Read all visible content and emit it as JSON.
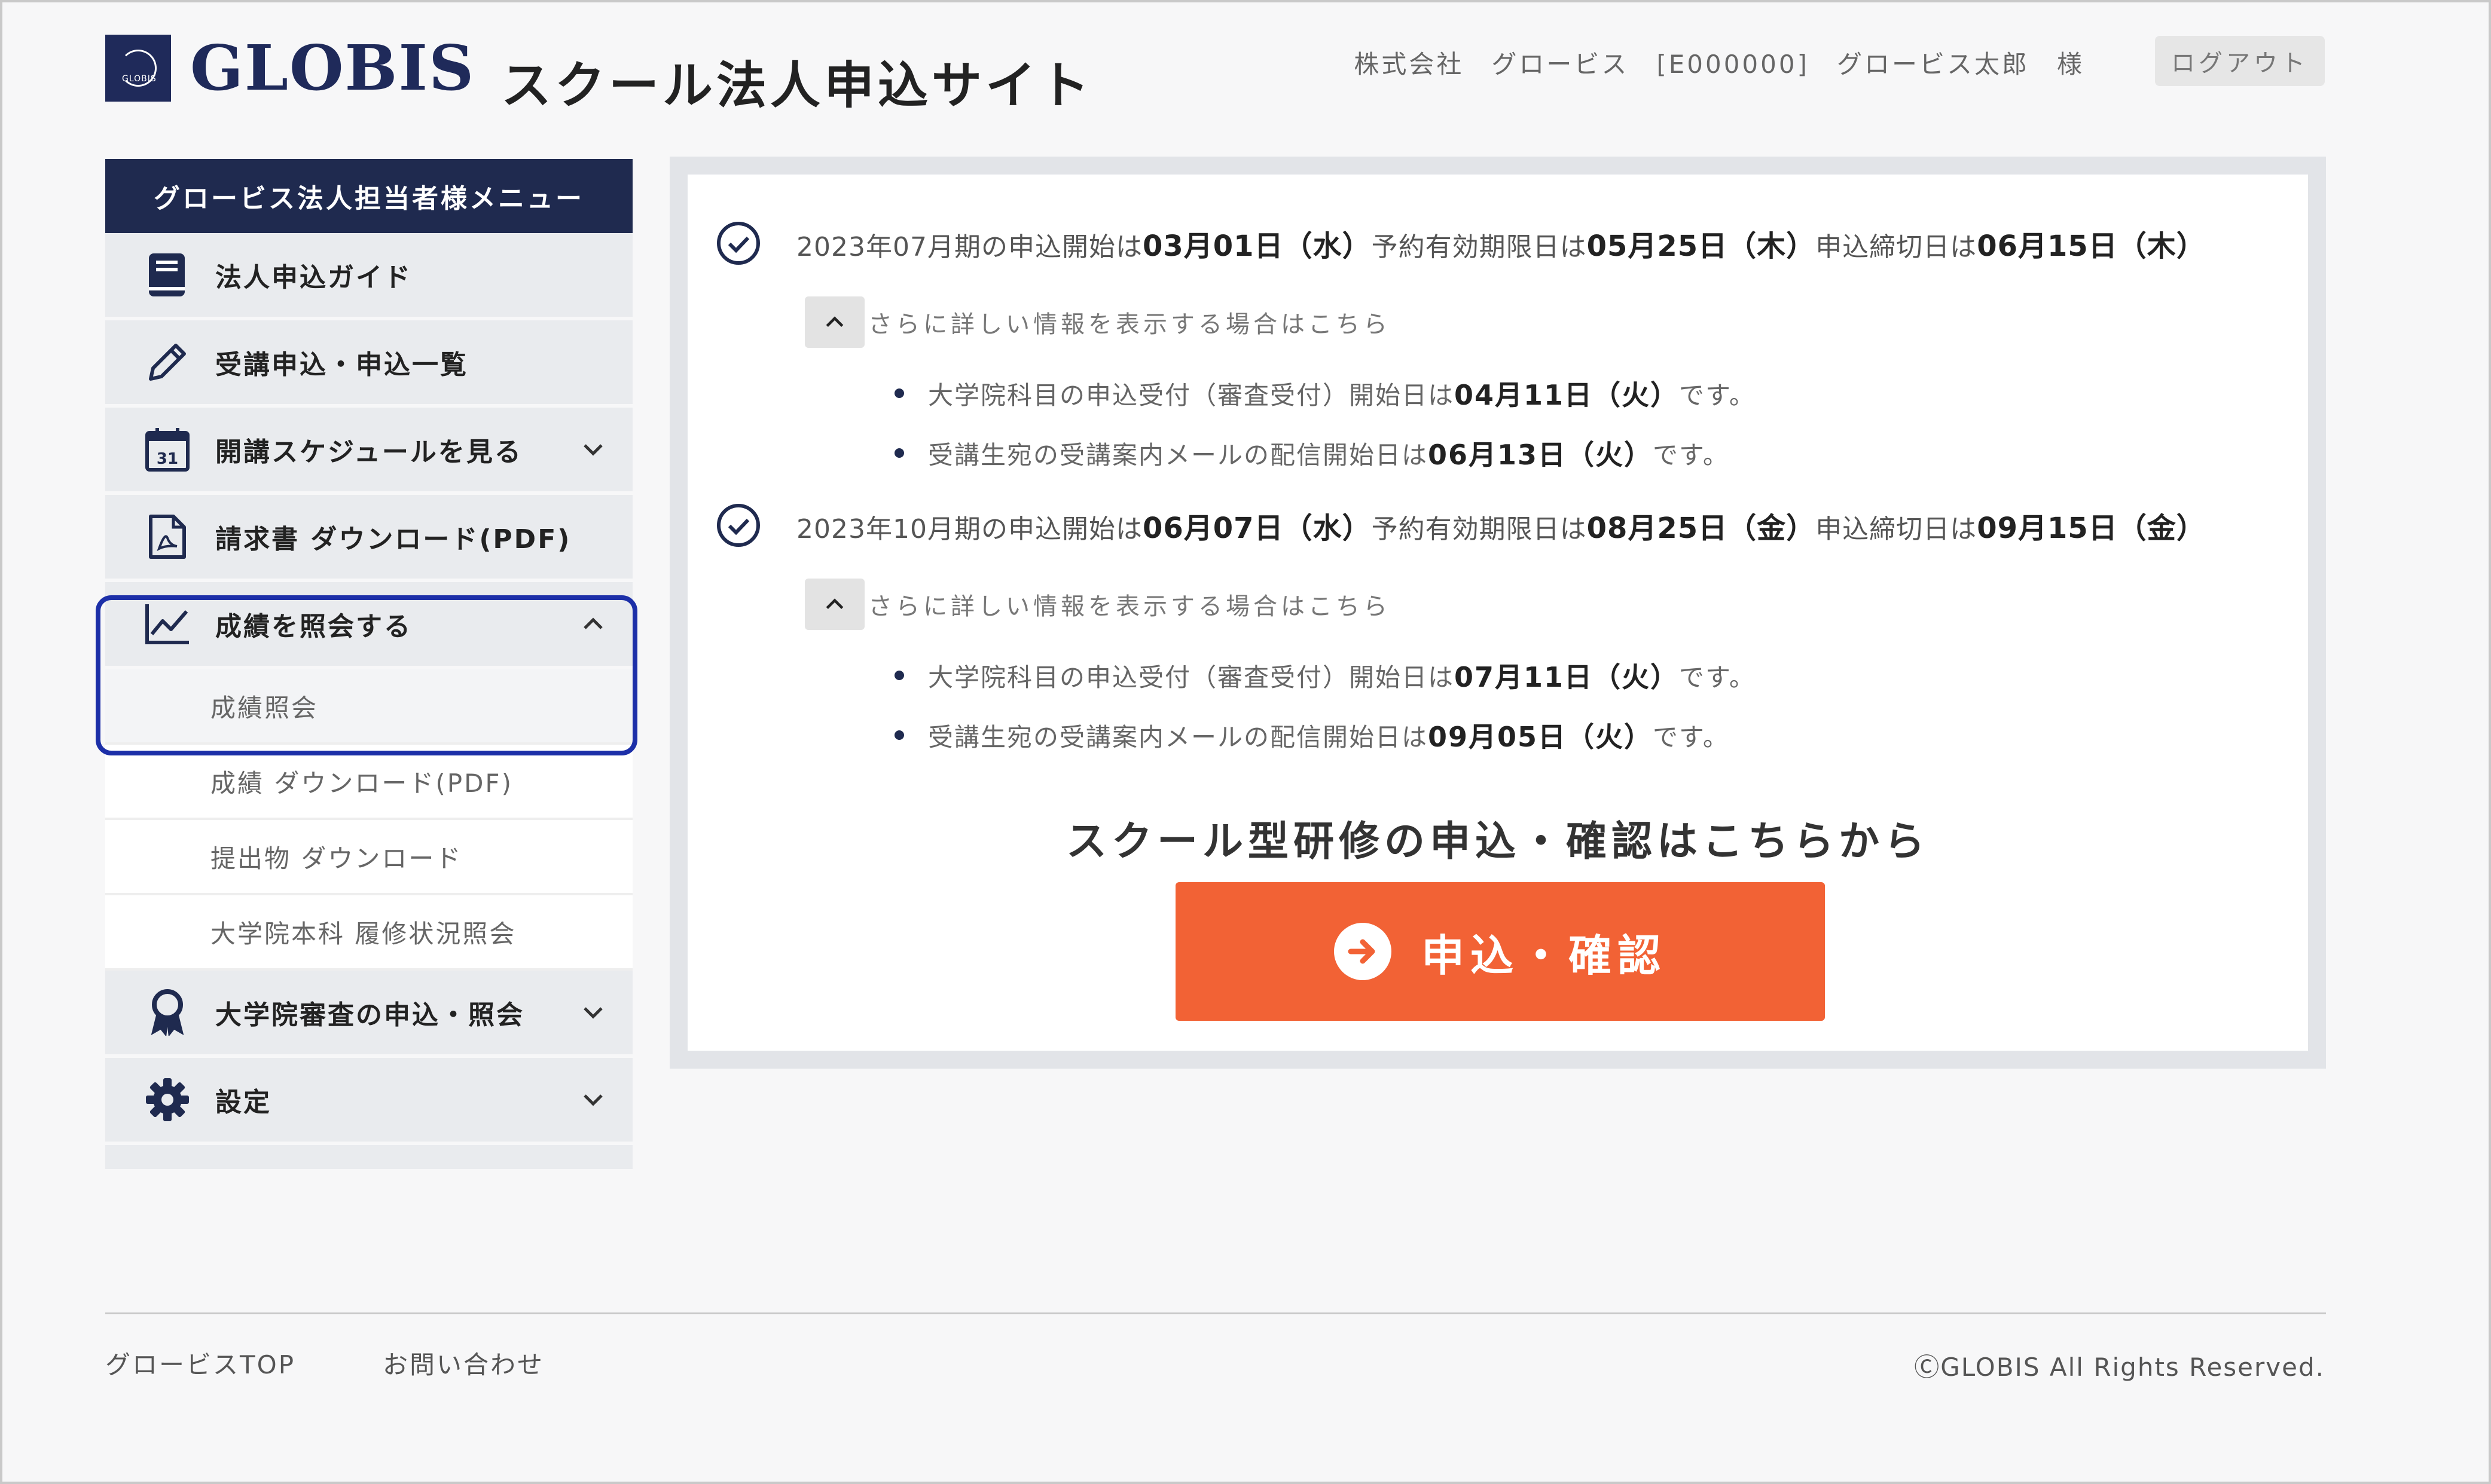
{
  "header": {
    "logo_text": "GLOBIS",
    "logo_small": "GLOBIS",
    "site_title": "スクール法人申込サイト",
    "company": "株式会社　グロービス",
    "code": "[E000000]",
    "user_name": "グロービス太郎　様",
    "logout_label": "ログアウト"
  },
  "sidebar": {
    "title": "グロービス法人担当者様メニュー",
    "items": [
      {
        "label": "法人申込ガイド",
        "icon": "book-icon"
      },
      {
        "label": "受講申込・申込一覧",
        "icon": "pencil-icon"
      },
      {
        "label": "開講スケジュールを見る",
        "icon": "calendar-icon",
        "calendar_day": "31"
      },
      {
        "label": "請求書 ダウンロード(PDF)",
        "icon": "pdf-icon"
      },
      {
        "label": "成績を照会する",
        "icon": "chart-icon"
      }
    ],
    "sub_items": [
      "成績照会",
      "成績 ダウンロード(PDF)",
      "提出物 ダウンロード",
      "大学院本科 履修状況照会"
    ],
    "items_after": [
      {
        "label": "大学院審査の申込・照会",
        "icon": "award-icon"
      },
      {
        "label": "設定",
        "icon": "gear-icon"
      }
    ]
  },
  "periods": [
    {
      "prefix": "2023年07月期の申込開始は",
      "start": "03月01日（水）",
      "mid1": "予約有効期限日は",
      "expiry": "05月25日（木）",
      "mid2": "申込締切日は",
      "deadline": "06月15日（木）",
      "more_text": "さらに詳しい情報を表示する場合はこちら",
      "bullets": [
        {
          "pre": "大学院科目の申込受付（審査受付）開始日は",
          "date": "04月11日（火）",
          "post": "です。"
        },
        {
          "pre": "受講生宛の受講案内メールの配信開始日は",
          "date": "06月13日（火）",
          "post": "です。"
        }
      ]
    },
    {
      "prefix": "2023年10月期の申込開始は",
      "start": "06月07日（水）",
      "mid1": "予約有効期限日は",
      "expiry": "08月25日（金）",
      "mid2": "申込締切日は",
      "deadline": "09月15日（金）",
      "more_text": "さらに詳しい情報を表示する場合はこちら",
      "bullets": [
        {
          "pre": "大学院科目の申込受付（審査受付）開始日は",
          "date": "07月11日（火）",
          "post": "です。"
        },
        {
          "pre": "受講生宛の受講案内メールの配信開始日は",
          "date": "09月05日（火）",
          "post": "です。"
        }
      ]
    }
  ],
  "cta": {
    "title": "スクール型研修の申込・確認はこちらから",
    "button_label": "申込・確認",
    "color": "#f26235"
  },
  "footer": {
    "links": [
      "グロービスTOP",
      "お問い合わせ"
    ],
    "copyright": "ⒸGLOBIS All Rights Reserved."
  },
  "colors": {
    "navy": "#1f2a4f",
    "highlight": "#1c2fa8",
    "orange": "#f26235"
  }
}
